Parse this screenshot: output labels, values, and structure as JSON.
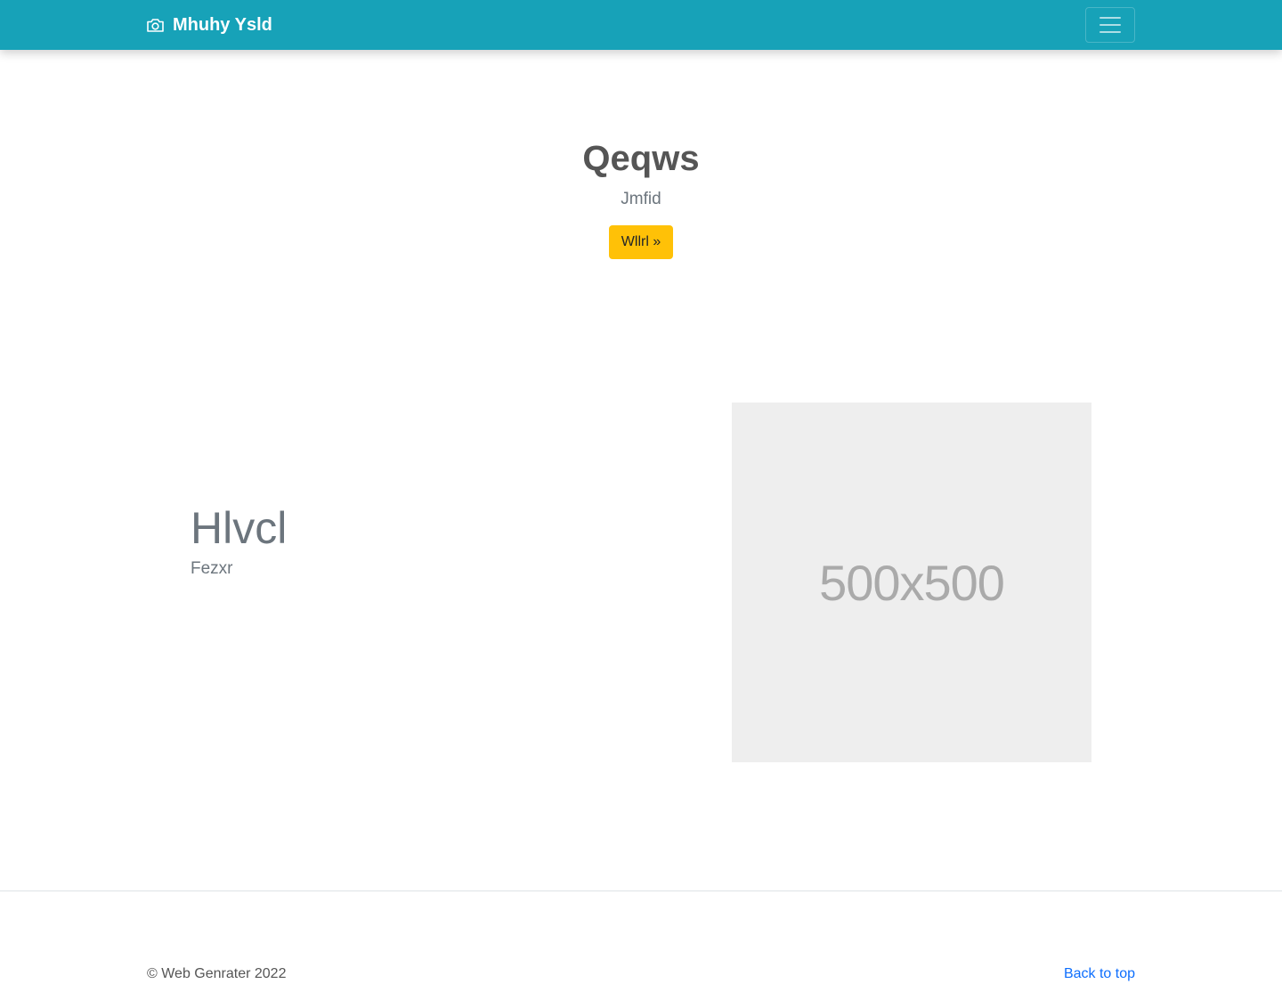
{
  "navbar": {
    "brand_name": "Mhuhy Ysld",
    "brand_icon": "camera-icon",
    "toggler_icon": "hamburger-menu-icon",
    "background_color": "#17a2b8"
  },
  "hero": {
    "title": "Qeqws",
    "subtitle": "Jmfid",
    "button_label": "Wllrl »",
    "button_color": "#ffc107"
  },
  "feature": {
    "title": "Hlvcl",
    "text": "Fezxr",
    "image_placeholder_label": "500x500"
  },
  "footer": {
    "copyright": "© Web Genrater 2022",
    "back_to_top_label": "Back to top",
    "link_color": "#0d6efd"
  }
}
